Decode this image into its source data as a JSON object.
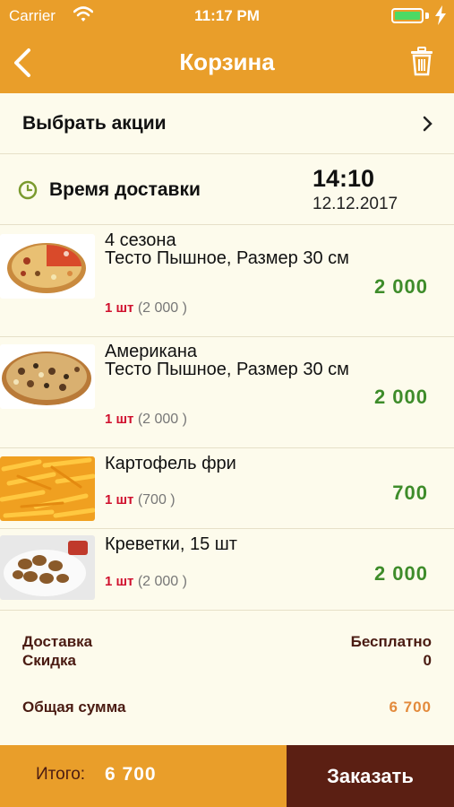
{
  "status_bar": {
    "carrier": "Carrier",
    "time": "11:17 PM"
  },
  "header": {
    "title": "Корзина"
  },
  "promo": {
    "label": "Выбрать акции"
  },
  "delivery": {
    "label": "Время доставки",
    "time": "14:10",
    "date": "12.12.2017"
  },
  "items": [
    {
      "name": "4 сезона\nТесто Пышное, Размер 30 см",
      "qty": "1 шт",
      "unit_price": "(2 000 )",
      "price": "2 000",
      "image": "pizza-four-seasons"
    },
    {
      "name": "Американа\nТесто Пышное, Размер 30 см",
      "qty": "1 шт",
      "unit_price": "(2 000 )",
      "price": "2 000",
      "image": "pizza-americana"
    },
    {
      "name": "Картофель фри",
      "qty": "1 шт",
      "unit_price": "(700 )",
      "price": "700",
      "image": "french-fries"
    },
    {
      "name": "Креветки, 15 шт",
      "qty": "1 шт",
      "unit_price": "(2 000 )",
      "price": "2 000",
      "image": "shrimp-plate"
    }
  ],
  "summary": {
    "delivery_label": "Доставка",
    "delivery_value": "Бесплатно",
    "discount_label": "Скидка",
    "discount_value": "0",
    "total_label": "Общая сумма",
    "total_value": "6 700"
  },
  "footer": {
    "total_label": "Итого:",
    "total_value": "6 700",
    "order_label": "Заказать"
  },
  "colors": {
    "accent": "#e99e2a",
    "dark": "#5b1f13",
    "price_green": "#3e8c2a",
    "qty_red": "#d0102d",
    "background": "#fdfbec"
  }
}
